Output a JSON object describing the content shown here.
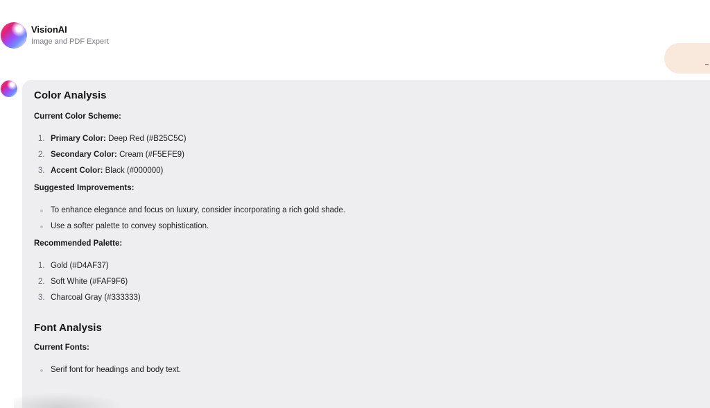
{
  "header": {
    "app_name": "VisionAI",
    "app_subtitle": "Image and PDF Expert",
    "avatar_icon": "gradient-orb-icon"
  },
  "message": {
    "color_section": {
      "title": "Color Analysis",
      "current_label": "Current Color Scheme:",
      "current_items": [
        {
          "num": "1.",
          "key": "Primary Color:",
          "value": "Deep Red (#B25C5C)"
        },
        {
          "num": "2.",
          "key": "Secondary Color:",
          "value": "Cream (#F5EFE9)"
        },
        {
          "num": "3.",
          "key": "Accent Color:",
          "value": "Black (#000000)"
        }
      ],
      "suggested_label": "Suggested Improvements:",
      "suggested_items": [
        "To enhance elegance and focus on luxury, consider incorporating a rich gold shade.",
        "Use a softer palette to convey sophistication."
      ],
      "recommended_label": "Recommended Palette:",
      "recommended_items": [
        {
          "num": "1.",
          "value": "Gold (#D4AF37)"
        },
        {
          "num": "2.",
          "value": "Soft White (#FAF9F6)"
        },
        {
          "num": "3.",
          "value": "Charcoal Gray (#333333)"
        }
      ]
    },
    "font_section": {
      "title": "Font Analysis",
      "current_label": "Current Fonts:",
      "current_items": [
        "Serif font for headings and body text."
      ]
    }
  },
  "colors": {
    "bubble_bg": "#eeeef1",
    "user_bubble_bg": "#f8e9dc"
  }
}
